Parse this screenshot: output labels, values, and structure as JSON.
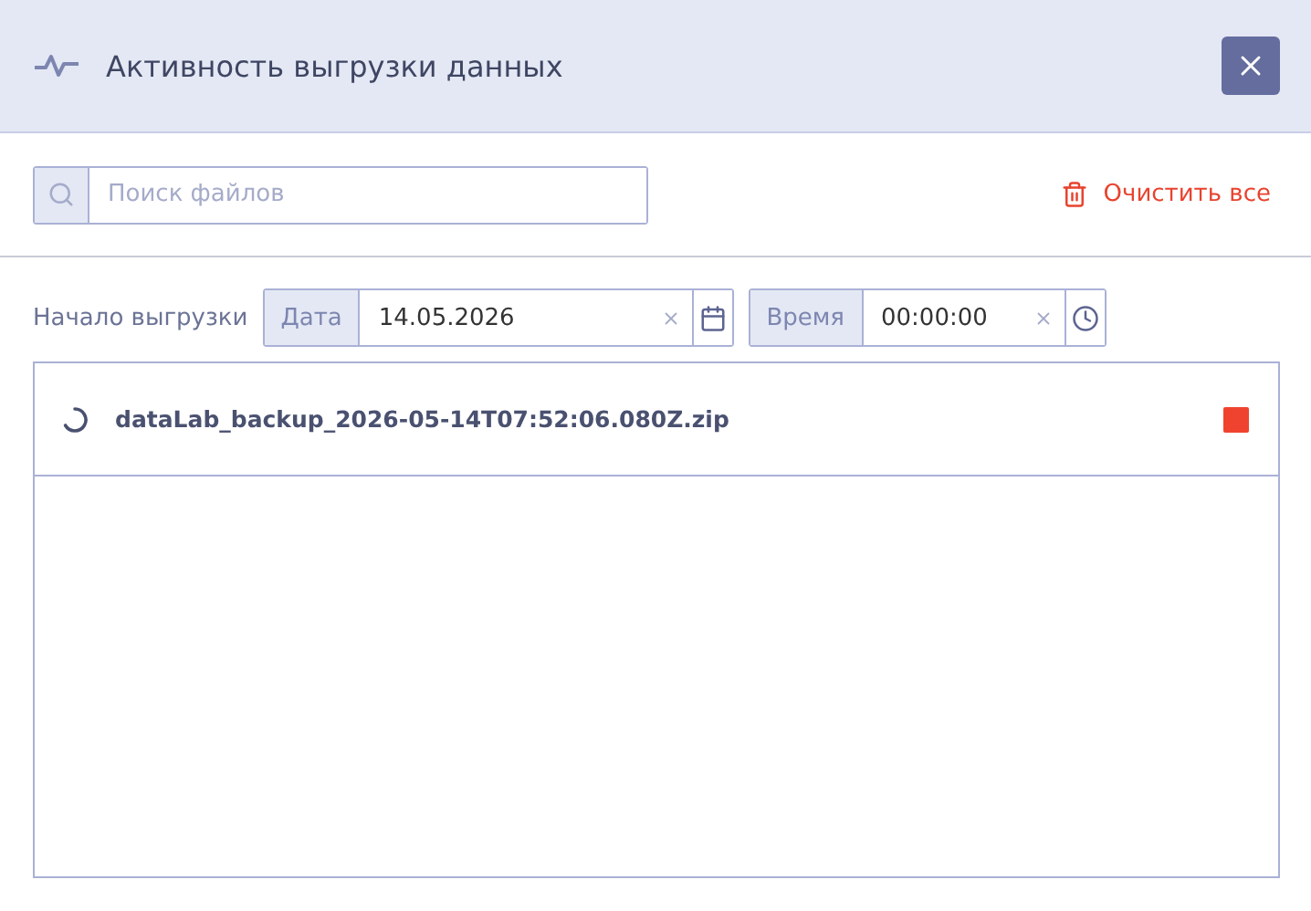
{
  "window": {
    "title": "Активность выгрузки данных"
  },
  "search": {
    "placeholder": "Поиск файлов"
  },
  "clear_all": {
    "label": "Очистить все"
  },
  "start": {
    "label": "Начало выгрузки",
    "date": {
      "addon": "Дата",
      "value": "14.05.2026"
    },
    "time": {
      "addon": "Время",
      "value": "00:00:00"
    }
  },
  "files": [
    {
      "name": "dataLab_backup_2026-05-14T07:52:06.080Z.zip",
      "in_progress": true
    }
  ]
}
